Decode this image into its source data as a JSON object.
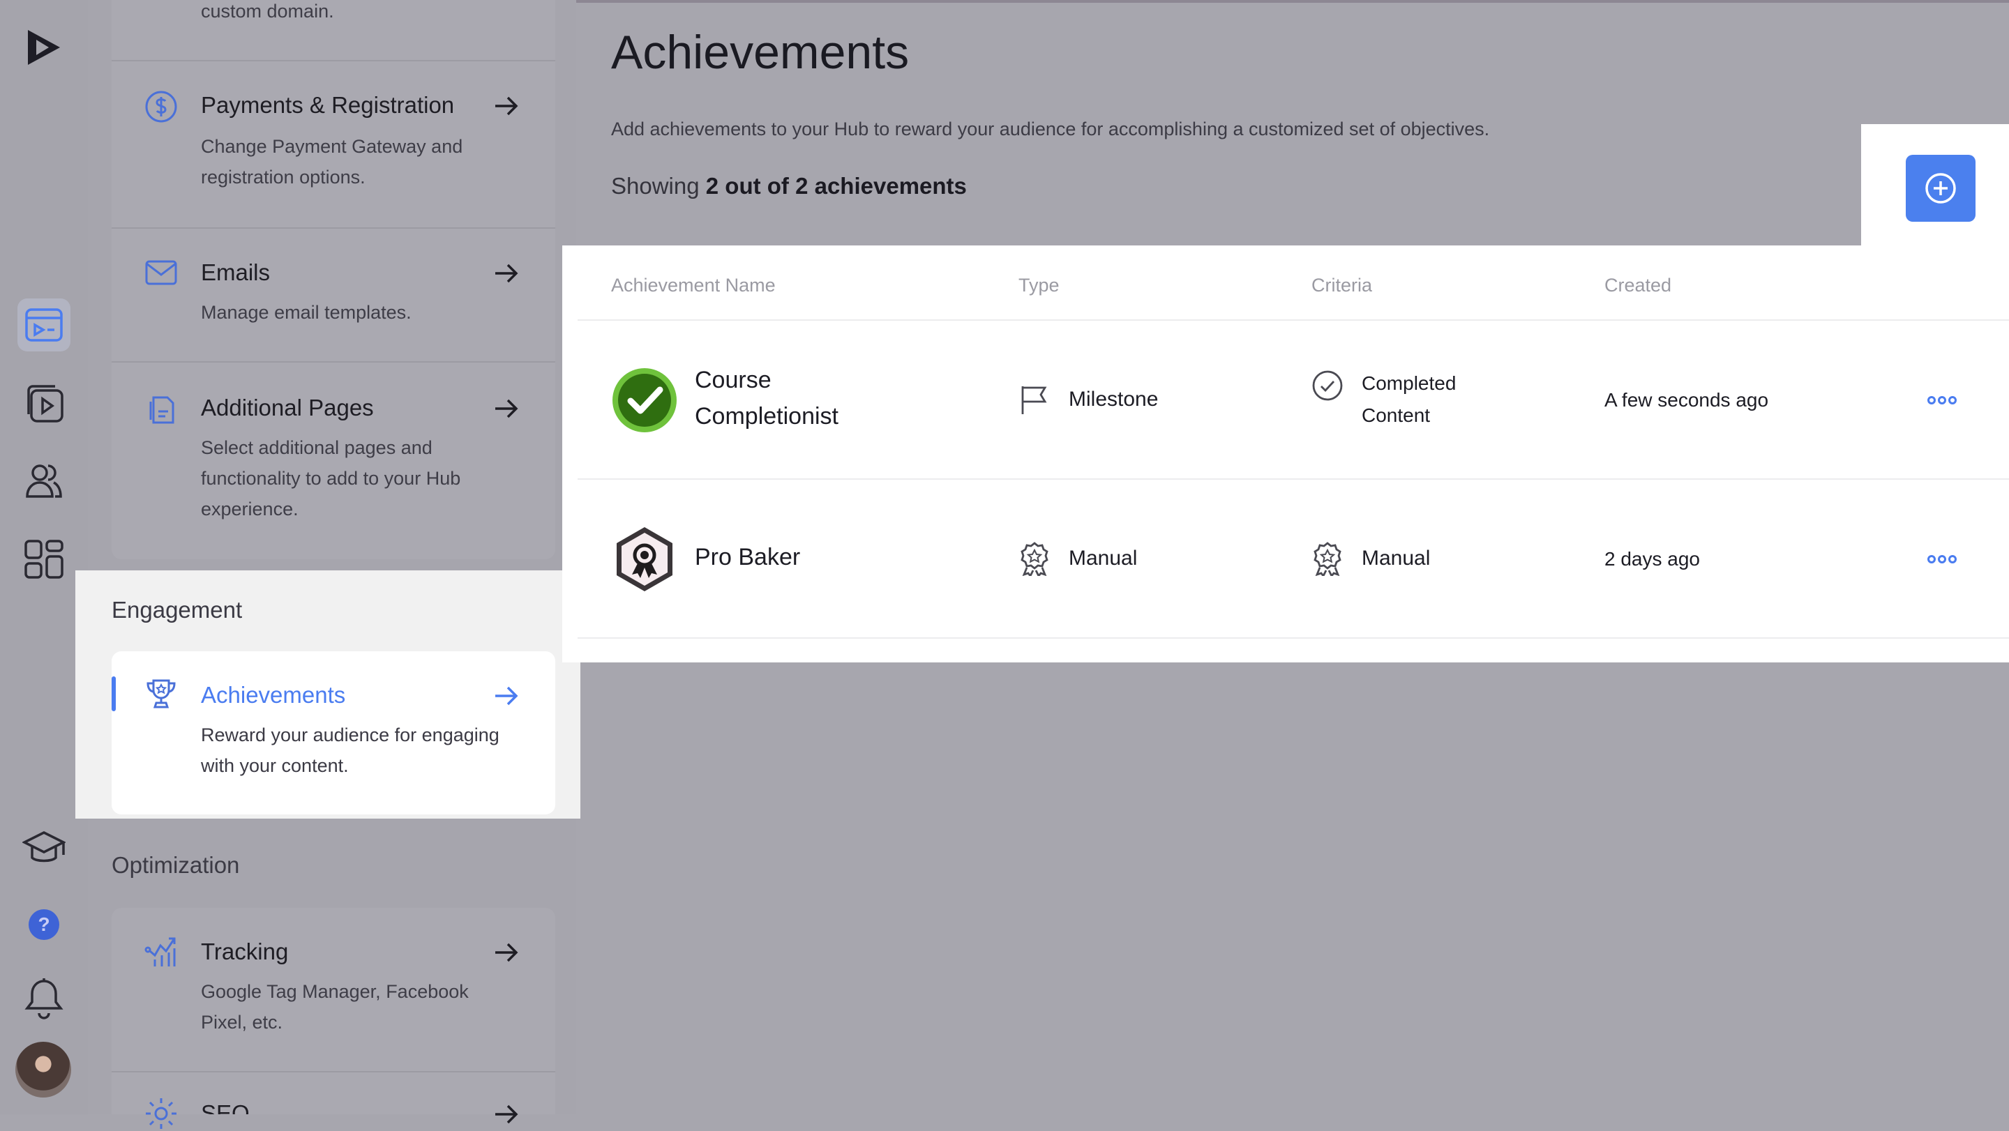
{
  "sidebar": {
    "top_fragment": "custom domain.",
    "cards": [
      {
        "title": "Payments & Registration",
        "desc": "Change Payment Gateway and registration options."
      },
      {
        "title": "Emails",
        "desc": "Manage email templates."
      },
      {
        "title": "Additional Pages",
        "desc": "Select additional pages and functionality to add to your Hub experience."
      }
    ],
    "section_engagement": "Engagement",
    "achievements_card": {
      "title": "Achievements",
      "desc": "Reward your audience for engaging with your content."
    },
    "section_optimization": "Optimization",
    "tracking_card": {
      "title": "Tracking",
      "desc": "Google Tag Manager, Facebook Pixel, etc."
    },
    "seo_fragment": "SEO"
  },
  "main": {
    "title": "Achievements",
    "subtitle": "Add achievements to your Hub to reward your audience for accomplishing a customized set of objectives.",
    "showing_prefix": "Showing",
    "showing_count": "2 out of 2 achievements",
    "table": {
      "headers": [
        "Achievement Name",
        "Type",
        "Criteria",
        "Created"
      ],
      "rows": [
        {
          "name_line1": "Course",
          "name_line2": "Completionist",
          "type": "Milestone",
          "criteria_line1": "Completed",
          "criteria_line2": "Content",
          "created": "A few seconds ago"
        },
        {
          "name": "Pro Baker",
          "type": "Manual",
          "criteria": "Manual",
          "created": "2 days ago"
        }
      ]
    }
  },
  "colors": {
    "accent": "#4b80ee",
    "badge_green": "#3d8b1f",
    "overlay": "#a7a6ae"
  },
  "icons": {
    "rail": [
      "brand-logo-icon",
      "hub-editor-icon",
      "videos-icon",
      "users-icon",
      "apps-grid-icon",
      "academy-icon",
      "help-icon",
      "notifications-bell-icon"
    ],
    "add": "plus-circle-icon",
    "more": "ellipsis-icon"
  }
}
